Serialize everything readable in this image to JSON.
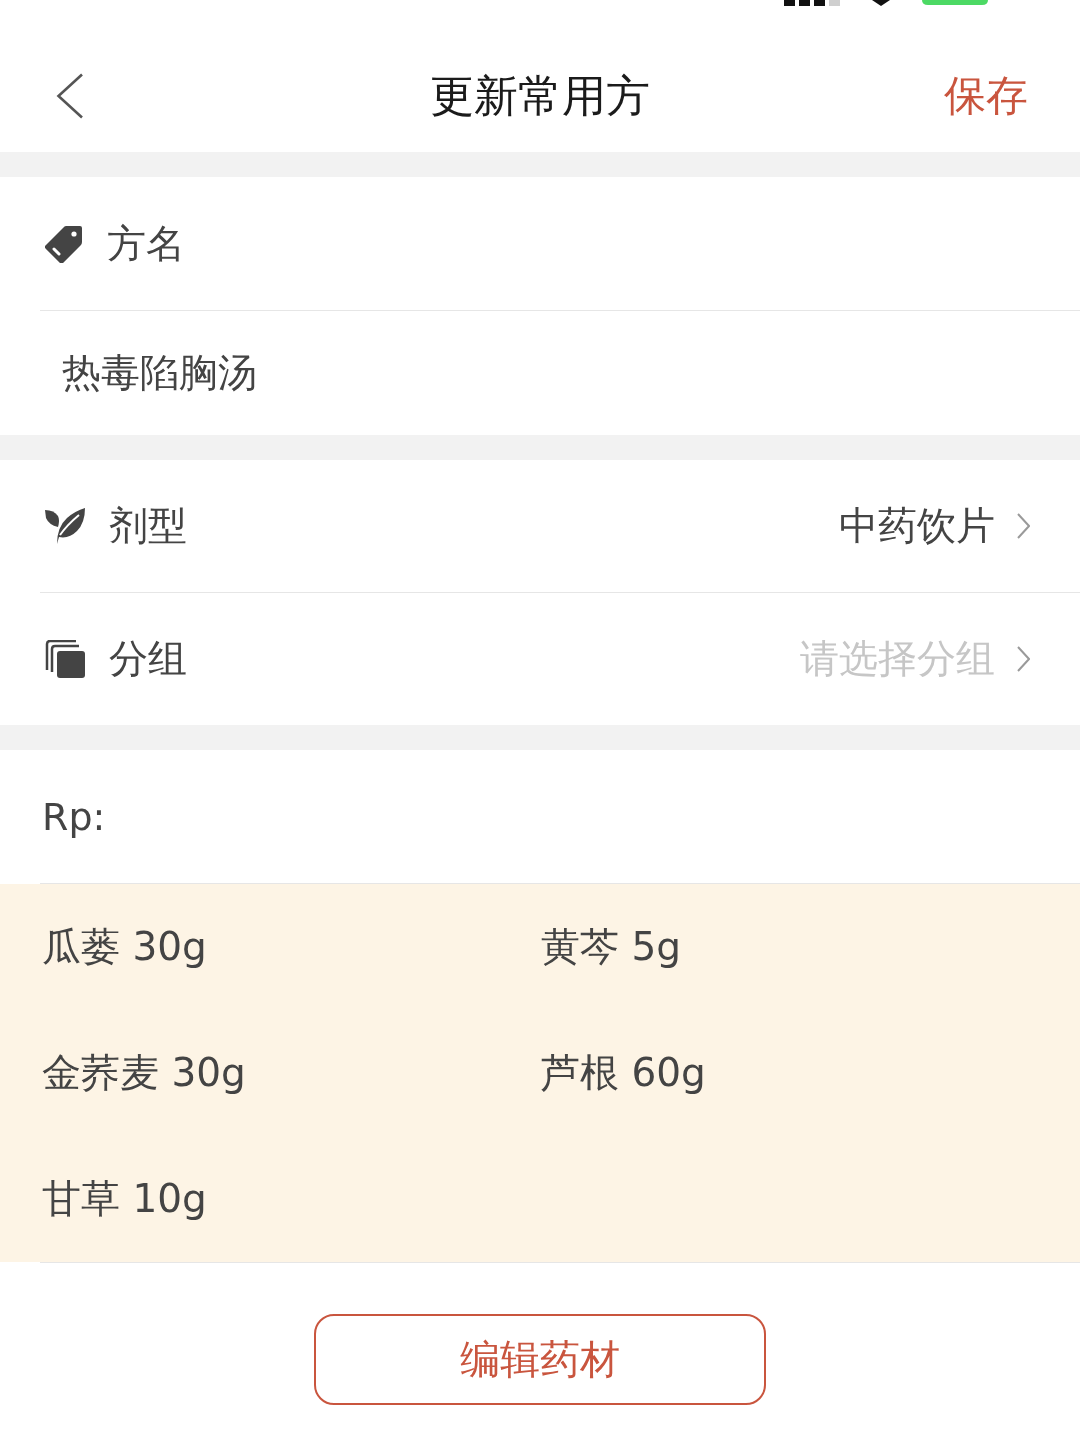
{
  "nav_bar": {
    "title": "更新常用方",
    "action": "保存"
  },
  "name_section": {
    "label": "方名",
    "value": "热毒陷胸汤"
  },
  "settings": [
    {
      "label": "剂型",
      "value": "中药饮片"
    },
    {
      "label": "分组",
      "placeholder": "请选择分组"
    }
  ],
  "prescription": {
    "label": "Rp:",
    "herbs": [
      "瓜蒌 30g",
      "黄芩 5g",
      "金荞麦 30g",
      "芦根 60g",
      "甘草 10g"
    ]
  },
  "edit_button": "编辑药材"
}
